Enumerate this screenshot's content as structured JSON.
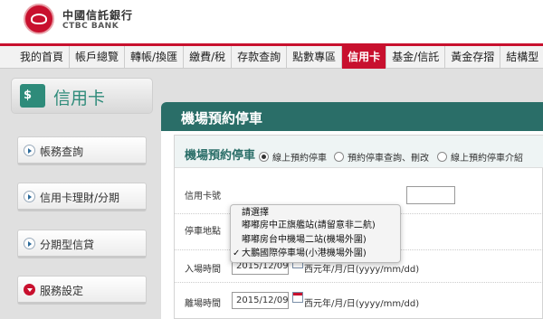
{
  "header": {
    "bank_name_cn": "中國信託銀行",
    "bank_name_en": "CTBC BANK"
  },
  "nav": {
    "items": [
      "我的首頁",
      "帳戶總覽",
      "轉帳/換匯",
      "繳費/稅",
      "存款查詢",
      "點數專區",
      "信用卡",
      "基金/信託",
      "黃金存摺",
      "結構型"
    ],
    "active_index": 6
  },
  "sidebar": {
    "title": "信用卡",
    "items": [
      {
        "label": "帳務查詢"
      },
      {
        "label": "信用卡理財/分期"
      },
      {
        "label": "分期型信貸"
      },
      {
        "label": "服務設定"
      }
    ]
  },
  "main": {
    "panel_title": "機場預約停車",
    "section_title": "機場預約停車",
    "radio_options": [
      "線上預約停車",
      "預約停車查詢、刪改",
      "線上預約停車介紹"
    ],
    "selected_radio": 0,
    "fields": {
      "card_label": "信用卡號",
      "location_label": "停車地點",
      "entry_label": "入場時間",
      "entry_value": "2015/12/09",
      "exit_label": "離場時間",
      "exit_value": "2015/12/09",
      "date_hint": "西元年/月/日(yyyy/mm/dd)"
    },
    "dropdown": {
      "options": [
        "請選擇",
        "嘟嘟房中正旗艦站(請留意非二航)",
        "嘟嘟房台中機場二站(機場外圍)",
        "大鵬國際停車場(小港機場外圍)"
      ],
      "selected_index": 3,
      "check_mark": "✓"
    }
  },
  "colors": {
    "brand_red": "#c8102e",
    "panel_teal": "#2a6e68",
    "sidebar_green": "#2e8b7a"
  }
}
